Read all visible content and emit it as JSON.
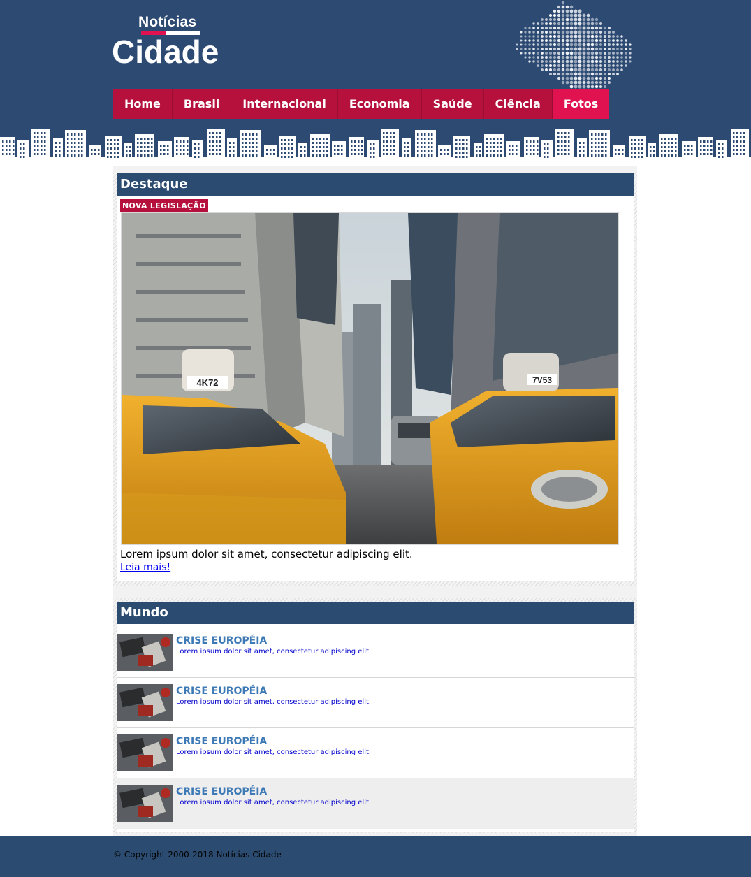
{
  "logo": {
    "top_text": "Notícias",
    "main_text": "Cidade"
  },
  "nav": {
    "items": [
      {
        "label": "Home"
      },
      {
        "label": "Brasil"
      },
      {
        "label": "Internacional"
      },
      {
        "label": "Economia"
      },
      {
        "label": "Saúde"
      },
      {
        "label": "Ciência"
      },
      {
        "label": "Fotos",
        "active": true
      }
    ]
  },
  "featured": {
    "section_title": "Destaque",
    "tag": "NOVA LEGISLAÇÃO",
    "image_alt": "Táxis amarelos em avenida entre arranha-céus",
    "plate_left": "4K72",
    "plate_right": "7V53",
    "caption": "Lorem ipsum dolor sit amet, consectetur adipiscing elit.",
    "link": "Leia mais!"
  },
  "world": {
    "section_title": "Mundo",
    "items": [
      {
        "title": "CRISE EUROPÉIA",
        "text": "Lorem ipsum dolor sit amet, consectetur adipiscing elit."
      },
      {
        "title": "CRISE EUROPÉIA",
        "text": "Lorem ipsum dolor sit amet, consectetur adipiscing elit."
      },
      {
        "title": "CRISE EUROPÉIA",
        "text": "Lorem ipsum dolor sit amet, consectetur adipiscing elit."
      },
      {
        "title": "CRISE EUROPÉIA",
        "text": "Lorem ipsum dolor sit amet, consectetur adipiscing elit.",
        "highlighted": true
      }
    ]
  },
  "footer": {
    "copyright": "© Copyright 2000-2018 Notícias Cidade"
  },
  "colors": {
    "header_bg": "#2d4a73",
    "nav_bg": "#b5113c",
    "nav_active": "#e0124f",
    "section_title_bg": "#2b4c70",
    "news_title": "#3d79b5"
  }
}
